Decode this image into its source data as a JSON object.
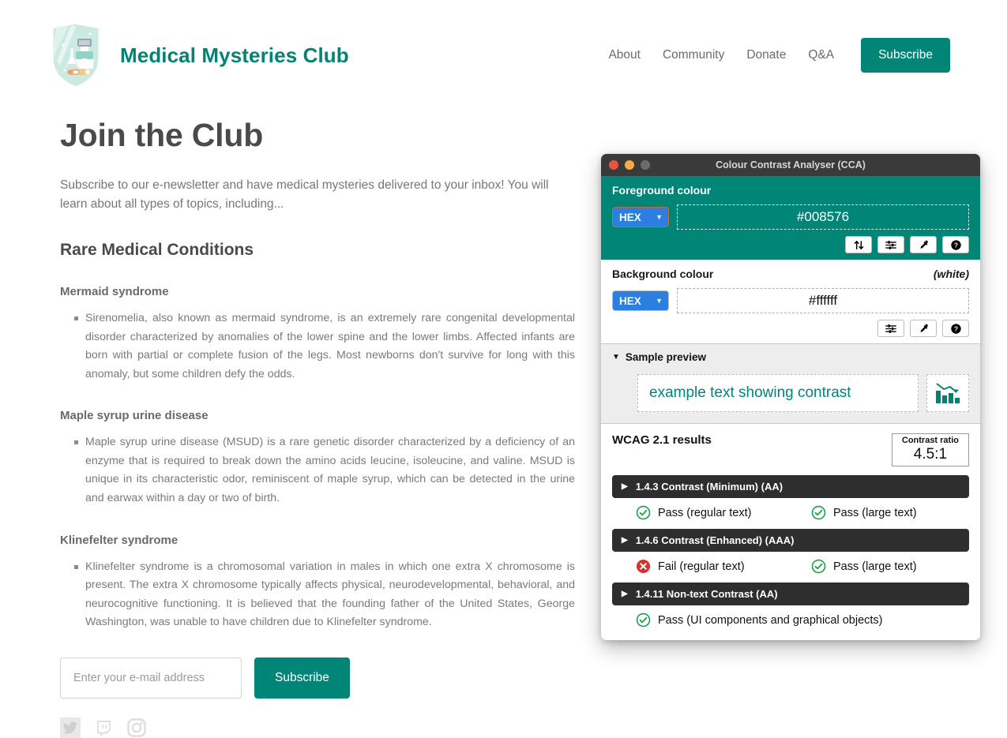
{
  "brand": {
    "title": "Medical Mysteries Club",
    "logo_icon": "medical-shield-badge-icon"
  },
  "nav": {
    "links": [
      {
        "label": "About"
      },
      {
        "label": "Community"
      },
      {
        "label": "Donate"
      },
      {
        "label": "Q&A"
      }
    ],
    "cta_label": "Subscribe"
  },
  "main": {
    "page_title": "Join the Club",
    "intro": "Subscribe to our e-newsletter and have medical mysteries delivered to your inbox! You will learn about all types of topics, including...",
    "section_title": "Rare Medical Conditions",
    "conditions": [
      {
        "title": "Mermaid syndrome",
        "body": "Sirenomelia, also known as mermaid syndrome, is an extremely rare congenital developmental disorder characterized by anomalies of the lower spine and the lower limbs. Affected infants are born with partial or complete fusion of the legs. Most newborns don't survive for long with this anomaly, but some children defy the odds."
      },
      {
        "title": "Maple syrup urine disease",
        "body": "Maple syrup urine disease (MSUD) is a rare genetic disorder characterized by a deficiency of an enzyme that is required to break down the amino acids leucine, isoleucine, and valine. MSUD is unique in its characteristic odor, reminiscent of maple syrup, which can be detected in the urine and earwax within a day or two of birth."
      },
      {
        "title": "Klinefelter syndrome",
        "body": "Klinefelter syndrome is a chromosomal variation in males in which one extra X chromosome is present. The extra X chromosome typically affects physical, neurodevelopmental, behavioral, and neurocognitive functioning. It is believed that the founding father of the United States, George Washington, was unable to have children due to Klinefelter syndrome."
      }
    ]
  },
  "subscribe_form": {
    "email_placeholder": "Enter your e-mail address",
    "email_value": "",
    "button_label": "Subscribe"
  },
  "socials": [
    {
      "icon": "twitter-icon"
    },
    {
      "icon": "twitch-icon"
    },
    {
      "icon": "instagram-icon"
    }
  ],
  "cca": {
    "window_title": "Colour Contrast Analyser (CCA)",
    "foreground": {
      "label": "Foreground colour",
      "format": "HEX",
      "value": "#008576",
      "tools": [
        "swap-colours-icon",
        "sliders-icon",
        "eyedropper-icon",
        "help-icon"
      ]
    },
    "background": {
      "label": "Background colour",
      "note": "(white)",
      "format": "HEX",
      "value": "#ffffff",
      "tools": [
        "sliders-icon",
        "eyedropper-icon",
        "help-icon"
      ]
    },
    "sample_preview": {
      "label": "Sample preview",
      "sample_text": "example text showing contrast",
      "graphic_icon": "bar-chart-decline-icon"
    },
    "results": {
      "title": "WCAG 2.1 results",
      "ratio_label": "Contrast ratio",
      "ratio_value": "4.5:1",
      "criteria": [
        {
          "name": "1.4.3 Contrast (Minimum) (AA)",
          "outcomes": [
            {
              "status": "pass",
              "text": "Pass (regular text)"
            },
            {
              "status": "pass",
              "text": "Pass (large text)"
            }
          ]
        },
        {
          "name": "1.4.6 Contrast (Enhanced) (AAA)",
          "outcomes": [
            {
              "status": "fail",
              "text": "Fail (regular text)"
            },
            {
              "status": "pass",
              "text": "Pass (large text)"
            }
          ]
        },
        {
          "name": "1.4.11 Non-text Contrast (AA)",
          "outcomes": [
            {
              "status": "pass",
              "text": "Pass (UI components and graphical objects)"
            }
          ]
        }
      ]
    }
  },
  "colors": {
    "brand_teal": "#008576",
    "brand_title_teal": "#048372",
    "pass_green": "#1aa34a",
    "fail_red": "#d8322c",
    "criterion_dark": "#2e2e2e",
    "titlebar_dark": "#3a3a3a"
  }
}
